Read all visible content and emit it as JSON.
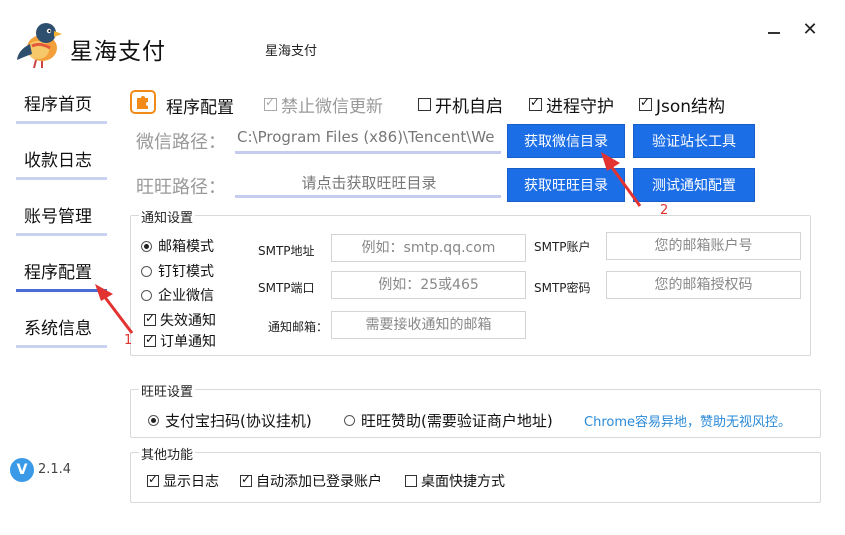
{
  "header": {
    "app_title": "星海支付",
    "window_title": "星海支付",
    "logo_icon": "bird-logo-icon",
    "minimize_icon": "minimize-icon",
    "close_icon": "close-icon",
    "close_glyph": "✕"
  },
  "sidebar": {
    "items": [
      {
        "label": "程序首页",
        "active": false
      },
      {
        "label": "收款日志",
        "active": false
      },
      {
        "label": "账号管理",
        "active": false
      },
      {
        "label": "程序配置",
        "active": true
      },
      {
        "label": "系统信息",
        "active": false
      }
    ]
  },
  "version": {
    "badge": "V",
    "text": "2.1.4"
  },
  "config": {
    "title": "程序配置",
    "options": [
      {
        "label": "禁止微信更新",
        "checked": true,
        "disabled": true
      },
      {
        "label": "开机自启",
        "checked": false,
        "disabled": false
      },
      {
        "label": "进程守护",
        "checked": true,
        "disabled": false
      },
      {
        "label": "Json结构",
        "checked": true,
        "disabled": false
      }
    ],
    "wechat_path": {
      "label": "微信路径：",
      "value": "C:\\Program Files (x86)\\Tencent\\We"
    },
    "wangwang_path": {
      "label": "旺旺路径：",
      "placeholder": "请点击获取旺旺目录"
    },
    "buttons": {
      "get_wechat_dir": "获取微信目录",
      "verify_tool": "验证站长工具",
      "get_wangwang_dir": "获取旺旺目录",
      "test_notify": "测试通知配置"
    }
  },
  "notify": {
    "group_title": "通知设置",
    "modes": [
      {
        "label": "邮箱模式",
        "selected": true
      },
      {
        "label": "钉钉模式",
        "selected": false
      },
      {
        "label": "企业微信",
        "selected": false
      }
    ],
    "checks": [
      {
        "label": "失效通知",
        "checked": true
      },
      {
        "label": "订单通知",
        "checked": true
      }
    ],
    "smtp_host_label": "SMTP地址",
    "smtp_host_placeholder": "例如：smtp.qq.com",
    "smtp_port_label": "SMTP端口",
    "smtp_port_placeholder": "例如：25或465",
    "notify_email_label": "通知邮箱：",
    "notify_email_placeholder": "需要接收通知的邮箱",
    "smtp_account_label": "SMTP账户",
    "smtp_account_placeholder": "您的邮箱账户号",
    "smtp_password_label": "SMTP密码",
    "smtp_password_placeholder": "您的邮箱授权码"
  },
  "wangwang": {
    "group_title": "旺旺设置",
    "options": [
      {
        "label": "支付宝扫码(协议挂机)",
        "selected": true
      },
      {
        "label": "旺旺赞助(需要验证商户地址)",
        "selected": false
      }
    ],
    "hint": "Chrome容易异地，赞助无视风控。"
  },
  "other": {
    "group_title": "其他功能",
    "checks": [
      {
        "label": "显示日志",
        "checked": true
      },
      {
        "label": "自动添加已登录账户",
        "checked": true
      },
      {
        "label": "桌面快捷方式",
        "checked": false
      }
    ]
  },
  "annotations": {
    "arrow1_number": "1",
    "arrow2_number": "2",
    "color": "#e23232"
  },
  "colors": {
    "accent_blue": "#1c6ee6",
    "nav_active_underline": "#4b6bd6",
    "nav_underline": "#c9d3ef",
    "hint_link": "#2a8ad8",
    "version_badge": "#3b9ae8",
    "config_icon": "#f28a1a"
  }
}
